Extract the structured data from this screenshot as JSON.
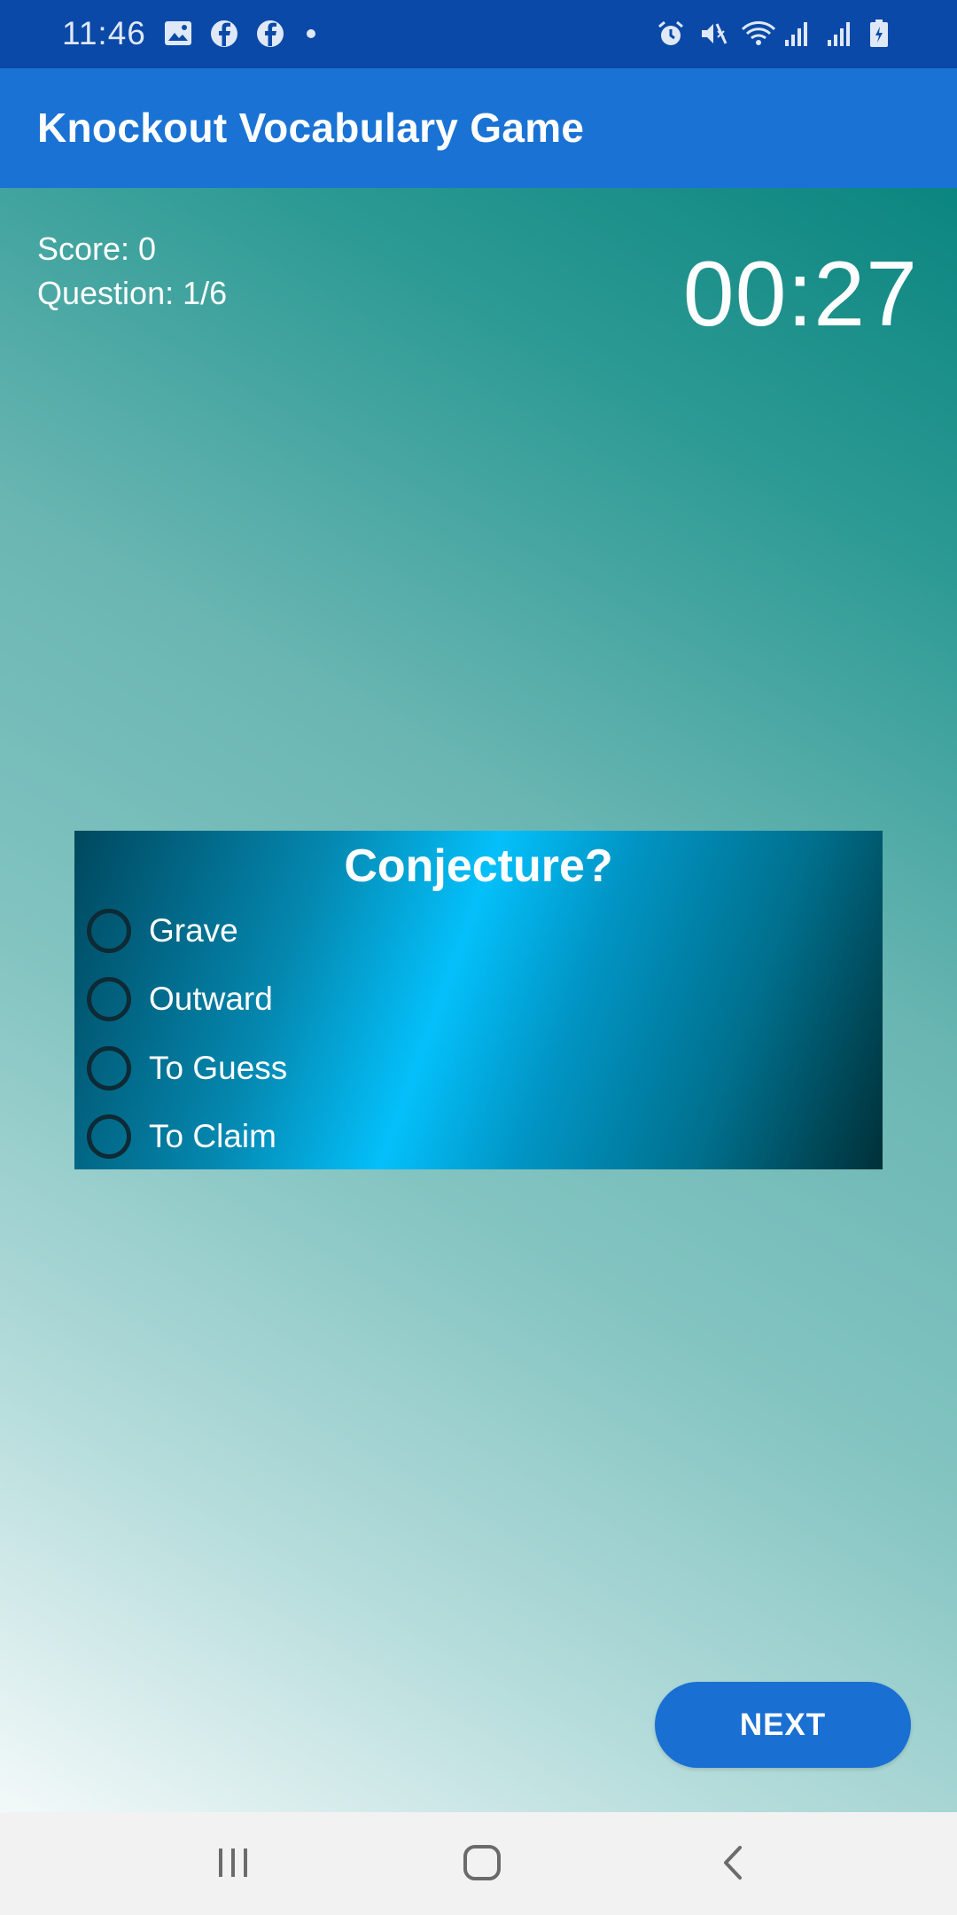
{
  "status_bar": {
    "time": "11:46",
    "left_icons": [
      "image-icon",
      "facebook-icon",
      "facebook-icon",
      "notification-dot"
    ],
    "right_icons": [
      "alarm-icon",
      "mute-icon",
      "wifi-icon",
      "signal-icon",
      "signal-icon",
      "battery-icon"
    ]
  },
  "app_bar": {
    "title": "Knockout Vocabulary Game"
  },
  "game": {
    "score_text": "Score: 0",
    "question_counter": "Question: 1/6",
    "timer": "00:27"
  },
  "question": {
    "word": "Conjecture?",
    "options": [
      {
        "label": "Grave",
        "selected": false
      },
      {
        "label": "Outward",
        "selected": false
      },
      {
        "label": "To Guess",
        "selected": false
      },
      {
        "label": "To Claim",
        "selected": false
      }
    ]
  },
  "next_button": {
    "label": "NEXT"
  },
  "nav_bar": {
    "buttons": [
      "recents-icon",
      "home-icon",
      "back-icon"
    ]
  },
  "colors": {
    "status_bar": "#0a49a8",
    "app_bar": "#1a73d4",
    "accent_button": "#1a6fd2",
    "card_highlight": "#04c0fa"
  }
}
